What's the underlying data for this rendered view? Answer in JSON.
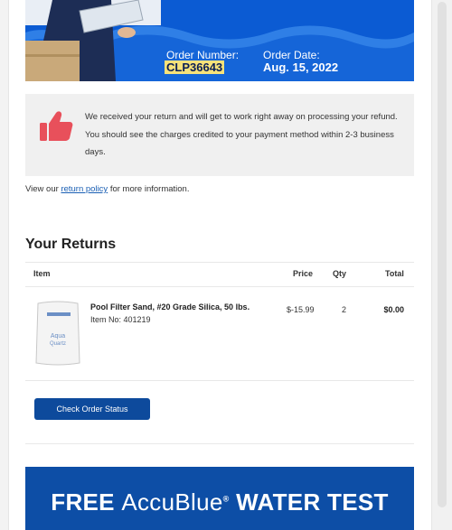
{
  "order": {
    "number_label": "Order Number:",
    "number": "CLP36643",
    "date_label": "Order Date:",
    "date": "Aug. 15, 2022"
  },
  "notice": {
    "icon": "thumbs-up-icon",
    "text": "We received your return and will get to work right away on processing your refund. You should see the charges credited to your payment method within 2-3 business days."
  },
  "policy": {
    "prefix": "View our ",
    "link": "return policy",
    "suffix": " for more information."
  },
  "returns": {
    "title": "Your Returns",
    "columns": {
      "item": "Item",
      "price": "Price",
      "qty": "Qty",
      "total": "Total"
    },
    "items": [
      {
        "name": "Pool Filter Sand, #20 Grade Silica, 50 lbs.",
        "item_no": "Item No: 401219",
        "price": "$-15.99",
        "qty": "2",
        "total": "$0.00"
      }
    ]
  },
  "button": {
    "label": "Check Order Status"
  },
  "banner": {
    "free": "FREE",
    "brand": "AccuBlue",
    "reg": "®",
    "rest": "WATER TEST"
  },
  "colors": {
    "hero_blue": "#0b5bd3",
    "button_blue": "#0d4a9c",
    "thumb_red": "#e8505b",
    "highlight": "#f7e27a"
  }
}
